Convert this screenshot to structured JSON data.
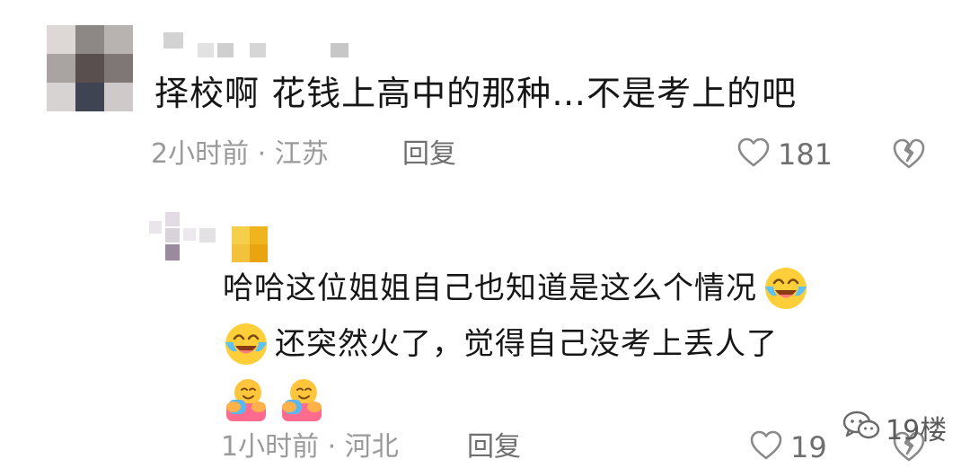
{
  "comments": [
    {
      "text": "择校啊 花钱上高中的那种…不是考上的吧",
      "time": "2小时前",
      "location": "江苏",
      "reply_label": "回复",
      "likes": "181"
    },
    {
      "line1": "哈哈这位姐姐自己也知道是这么个情况",
      "line2": "还突然火了，觉得自己没考上丢人了",
      "time": "1小时前",
      "location": "河北",
      "reply_label": "回复",
      "likes": "19"
    }
  ],
  "separator": "·",
  "watermark": "19楼",
  "icons": {
    "like": "heart-outline-icon",
    "dislike": "broken-heart-icon",
    "emoji_laugh": "laughing-crying-emoji",
    "emoji_hug": "hugging-face-emoji",
    "watermark": "wechat-icon"
  },
  "colors": {
    "text": "#161616",
    "meta": "#9a9a9a",
    "action": "#6f6f6f"
  }
}
